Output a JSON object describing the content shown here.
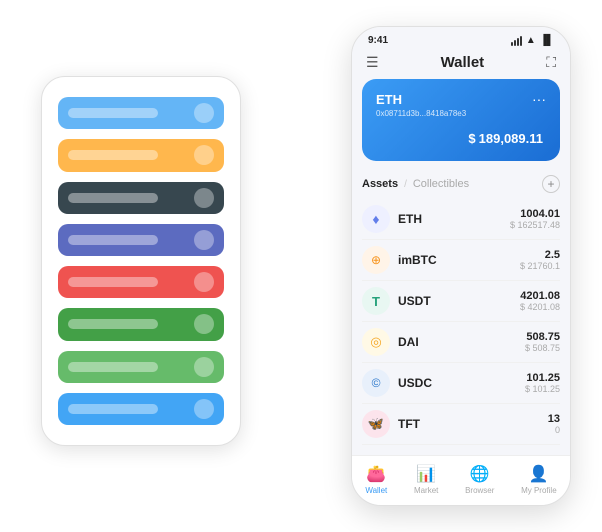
{
  "scene": {
    "back_phone": {
      "cards": [
        {
          "color": "#64b5f6",
          "label_width": "80px"
        },
        {
          "color": "#ffb74d",
          "label_width": "70px"
        },
        {
          "color": "#37474f",
          "label_width": "75px"
        },
        {
          "color": "#5c6bc0",
          "label_width": "65px"
        },
        {
          "color": "#ef5350",
          "label_width": "72px"
        },
        {
          "color": "#43a047",
          "label_width": "78px"
        },
        {
          "color": "#66bb6a",
          "label_width": "68px"
        },
        {
          "color": "#42a5f5",
          "label_width": "73px"
        }
      ]
    },
    "front_phone": {
      "status_bar": {
        "time": "9:41",
        "signal": "▌▌▌",
        "wifi": "WiFi",
        "battery": "🔋"
      },
      "header": {
        "menu_icon": "☰",
        "title": "Wallet",
        "expand_icon": "⛶"
      },
      "eth_card": {
        "title": "ETH",
        "address": "0x08711d3b...8418a78e3",
        "icon": "🏷",
        "more": "...",
        "amount_symbol": "$",
        "amount": "189,089.11"
      },
      "assets_section": {
        "tab_active": "Assets",
        "tab_divider": "/",
        "tab_inactive": "Collectibles",
        "add_icon": "+"
      },
      "assets": [
        {
          "name": "ETH",
          "icon_color": "#627eea",
          "icon_text": "♦",
          "amount": "1004.01",
          "usd": "$ 162517.48"
        },
        {
          "name": "imBTC",
          "icon_color": "#f7931a",
          "icon_text": "⊕",
          "amount": "2.5",
          "usd": "$ 21760.1"
        },
        {
          "name": "USDT",
          "icon_color": "#26a17b",
          "icon_text": "T",
          "amount": "4201.08",
          "usd": "$ 4201.08"
        },
        {
          "name": "DAI",
          "icon_color": "#f5a623",
          "icon_text": "◎",
          "amount": "508.75",
          "usd": "$ 508.75"
        },
        {
          "name": "USDC",
          "icon_color": "#2775ca",
          "icon_text": "©",
          "amount": "101.25",
          "usd": "$ 101.25"
        },
        {
          "name": "TFT",
          "icon_color": "#e91e63",
          "icon_text": "🦋",
          "amount": "13",
          "usd": "0"
        }
      ],
      "nav": [
        {
          "icon": "👛",
          "label": "Wallet",
          "active": true
        },
        {
          "icon": "📊",
          "label": "Market",
          "active": false
        },
        {
          "icon": "🌐",
          "label": "Browser",
          "active": false
        },
        {
          "icon": "👤",
          "label": "My Profile",
          "active": false
        }
      ]
    }
  }
}
